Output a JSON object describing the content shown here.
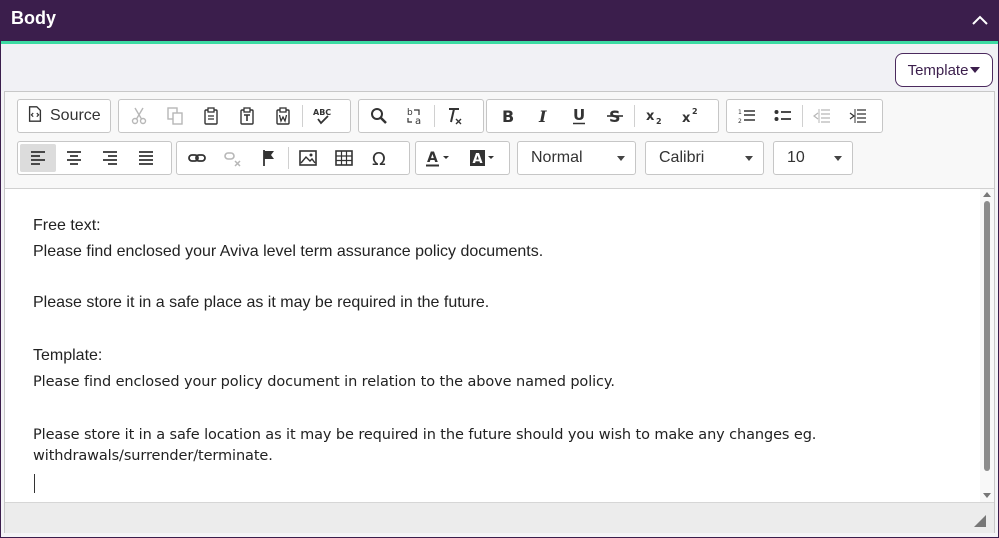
{
  "header": {
    "title": "Body",
    "collapse_icon": "chevron-up-icon"
  },
  "template_button": {
    "label": "Template"
  },
  "toolbar": {
    "source_label": "Source",
    "format_value": "Normal",
    "font_value": "Calibri",
    "size_value": "10",
    "icons": {
      "source": "source-icon",
      "cut": "cut-icon",
      "copy": "copy-icon",
      "paste": "paste-icon",
      "paste_text": "paste-text-icon",
      "paste_word": "paste-word-icon",
      "spellcheck": "spellcheck-icon",
      "find": "find-icon",
      "replace": "replace-icon",
      "remove_format": "remove-format-icon",
      "bold": "bold-icon",
      "italic": "italic-icon",
      "underline": "underline-icon",
      "strike": "strikethrough-icon",
      "subscript": "subscript-icon",
      "superscript": "superscript-icon",
      "numbered_list": "numbered-list-icon",
      "bulleted_list": "bulleted-list-icon",
      "outdent": "outdent-icon",
      "indent": "indent-icon",
      "align_left": "align-left-icon",
      "align_center": "align-center-icon",
      "align_right": "align-right-icon",
      "justify": "justify-icon",
      "link": "link-icon",
      "unlink": "unlink-icon",
      "anchor": "anchor-flag-icon",
      "image": "image-icon",
      "table": "table-icon",
      "special_char": "omega-icon",
      "text_color": "text-color-icon",
      "bg_color": "background-color-icon"
    }
  },
  "content": {
    "free_text_label": "Free text:",
    "free_line1": "Please find enclosed your Aviva level term assurance policy documents.",
    "free_line2": "Please store it in a safe place as it may be required in the future.",
    "template_label": "Template:",
    "template_line1": "Please find enclosed your policy document in relation to the above named policy.",
    "template_line2": "Please store it in a safe location as it may be required in the future should you wish to make any changes eg.",
    "template_line3": "withdrawals/surrender/terminate."
  }
}
